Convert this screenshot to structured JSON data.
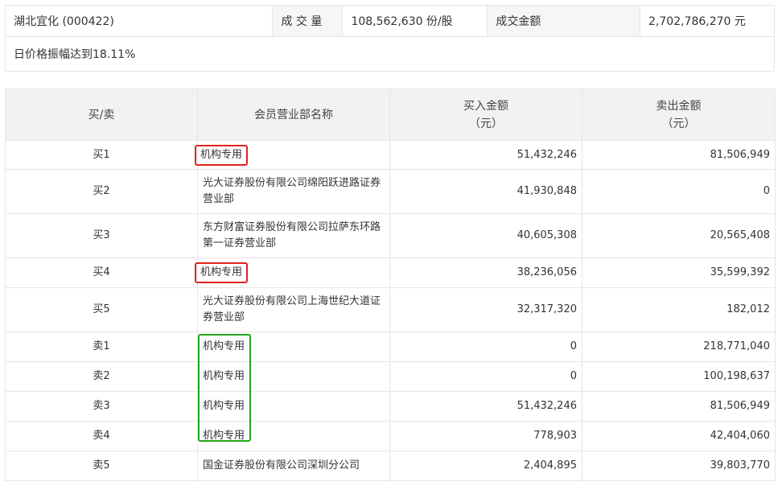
{
  "summary": {
    "stock": "湖北宜化 (000422)",
    "volume_label": "成 交 量",
    "volume_value": "108,562,630 份/股",
    "amount_label": "成交金额",
    "amount_value": "2,702,786,270 元",
    "reason": "日价格振幅达到18.11%"
  },
  "table": {
    "headers": {
      "side": "买/卖",
      "member": "会员营业部名称",
      "buy_amount_1": "买入金额",
      "buy_amount_2": "（元）",
      "sell_amount_1": "卖出金额",
      "sell_amount_2": "（元）"
    },
    "rows": [
      {
        "side": "买1",
        "name": "机构专用",
        "buy": "51,432,246",
        "sell": "81,506,949"
      },
      {
        "side": "买2",
        "name": "光大证券股份有限公司绵阳跃进路证券营业部",
        "buy": "41,930,848",
        "sell": "0"
      },
      {
        "side": "买3",
        "name": "东方财富证券股份有限公司拉萨东环路第一证券营业部",
        "buy": "40,605,308",
        "sell": "20,565,408"
      },
      {
        "side": "买4",
        "name": "机构专用",
        "buy": "38,236,056",
        "sell": "35,599,392"
      },
      {
        "side": "买5",
        "name": "光大证券股份有限公司上海世纪大道证券营业部",
        "buy": "32,317,320",
        "sell": "182,012"
      },
      {
        "side": "卖1",
        "name": "机构专用",
        "buy": "0",
        "sell": "218,771,040"
      },
      {
        "side": "卖2",
        "name": "机构专用",
        "buy": "0",
        "sell": "100,198,637"
      },
      {
        "side": "卖3",
        "name": "机构专用",
        "buy": "51,432,246",
        "sell": "81,506,949"
      },
      {
        "side": "卖4",
        "name": "机构专用",
        "buy": "778,903",
        "sell": "42,404,060"
      },
      {
        "side": "卖5",
        "name": "国金证券股份有限公司深圳分公司",
        "buy": "2,404,895",
        "sell": "39,803,770"
      }
    ]
  },
  "colors": {
    "highlight_red": "#e0231c",
    "highlight_green": "#24a51c"
  }
}
